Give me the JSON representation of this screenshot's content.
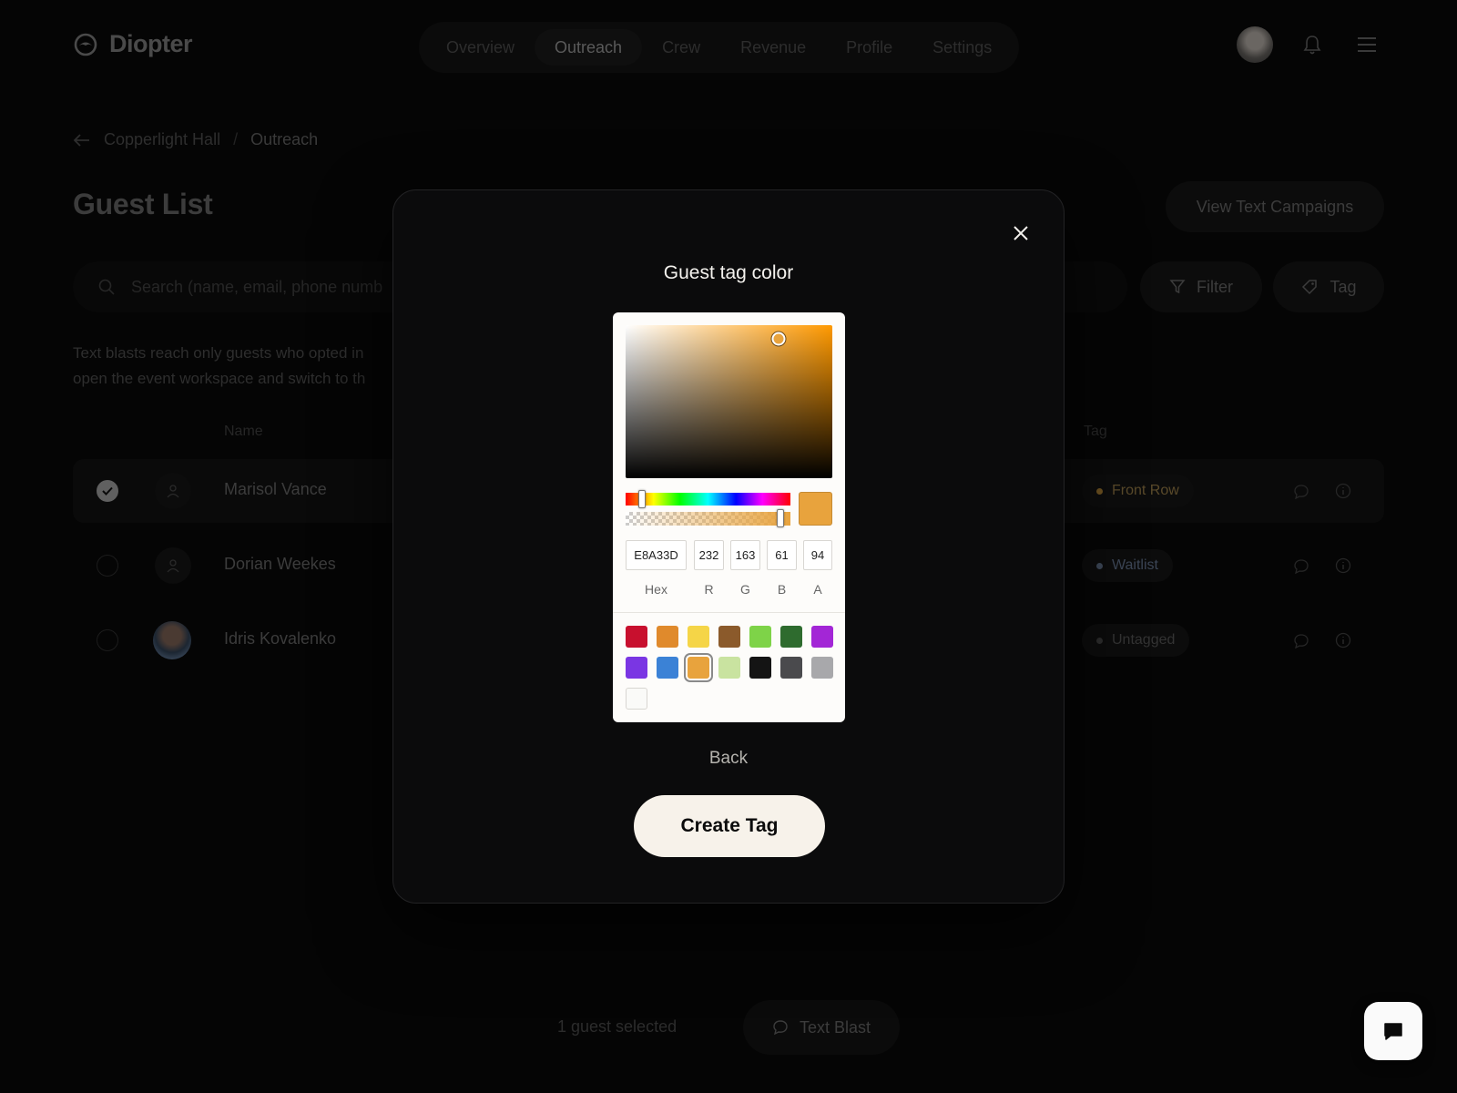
{
  "app": {
    "name": "Diopter"
  },
  "nav": {
    "items": [
      "Overview",
      "Outreach",
      "Crew",
      "Revenue",
      "Profile",
      "Settings"
    ],
    "active": "Outreach"
  },
  "breadcrumb": {
    "parent": "Copperlight Hall",
    "current": "Outreach"
  },
  "page": {
    "title": "Guest List",
    "view_campaigns_label": "View Text Campaigns"
  },
  "search": {
    "placeholder": "Search (name, email, phone numb"
  },
  "toolbar": {
    "filter_label": "Filter",
    "tag_label": "Tag"
  },
  "note": {
    "line1": "Text blasts reach only guests who opted in",
    "line2": "open the event workspace and switch to th"
  },
  "table": {
    "headers": {
      "name": "Name",
      "tag": "Tag"
    },
    "rows": [
      {
        "name": "Marisol Vance",
        "tag": "Front Row",
        "tag_color": "#b8893a",
        "selected": true,
        "avatar": "placeholder"
      },
      {
        "name": "Dorian Weekes",
        "tag": "Waitlist",
        "tag_color": "#7a8a9c",
        "selected": false,
        "avatar": "placeholder"
      },
      {
        "name": "Idris Kovalenko",
        "tag": "Untagged",
        "tag_color": "#3a3a3a",
        "selected": false,
        "avatar": "photo"
      }
    ]
  },
  "footer": {
    "selected_text": "1 guest selected",
    "text_blast_label": "Text Blast"
  },
  "modal": {
    "title": "Guest tag color",
    "back_label": "Back",
    "create_label": "Create Tag",
    "picker": {
      "hex": "E8A33D",
      "r": "232",
      "g": "163",
      "b": "61",
      "a": "94",
      "labels": {
        "hex": "Hex",
        "r": "R",
        "g": "G",
        "b": "B",
        "a": "A"
      },
      "hue_degrees": 36,
      "saturation": 0.74,
      "brightness": 0.91,
      "alpha": 0.94,
      "current_color": "#E8A33D",
      "swatches": [
        "#c8102e",
        "#e08a2c",
        "#f5d547",
        "#8b5a2b",
        "#7ed348",
        "#2e6b2e",
        "#a326d6",
        "#7a36e3",
        "#3b82d6",
        "#e8a33d",
        "#c9e3a0",
        "#141414",
        "#4a4a4d",
        "#a8a8ab",
        "#fafaf8"
      ],
      "selected_swatch": 9
    }
  },
  "colors": {
    "accent": "#E8A33D",
    "modal_bg": "#0b0b0c",
    "button_bg": "#f7f2ea"
  }
}
